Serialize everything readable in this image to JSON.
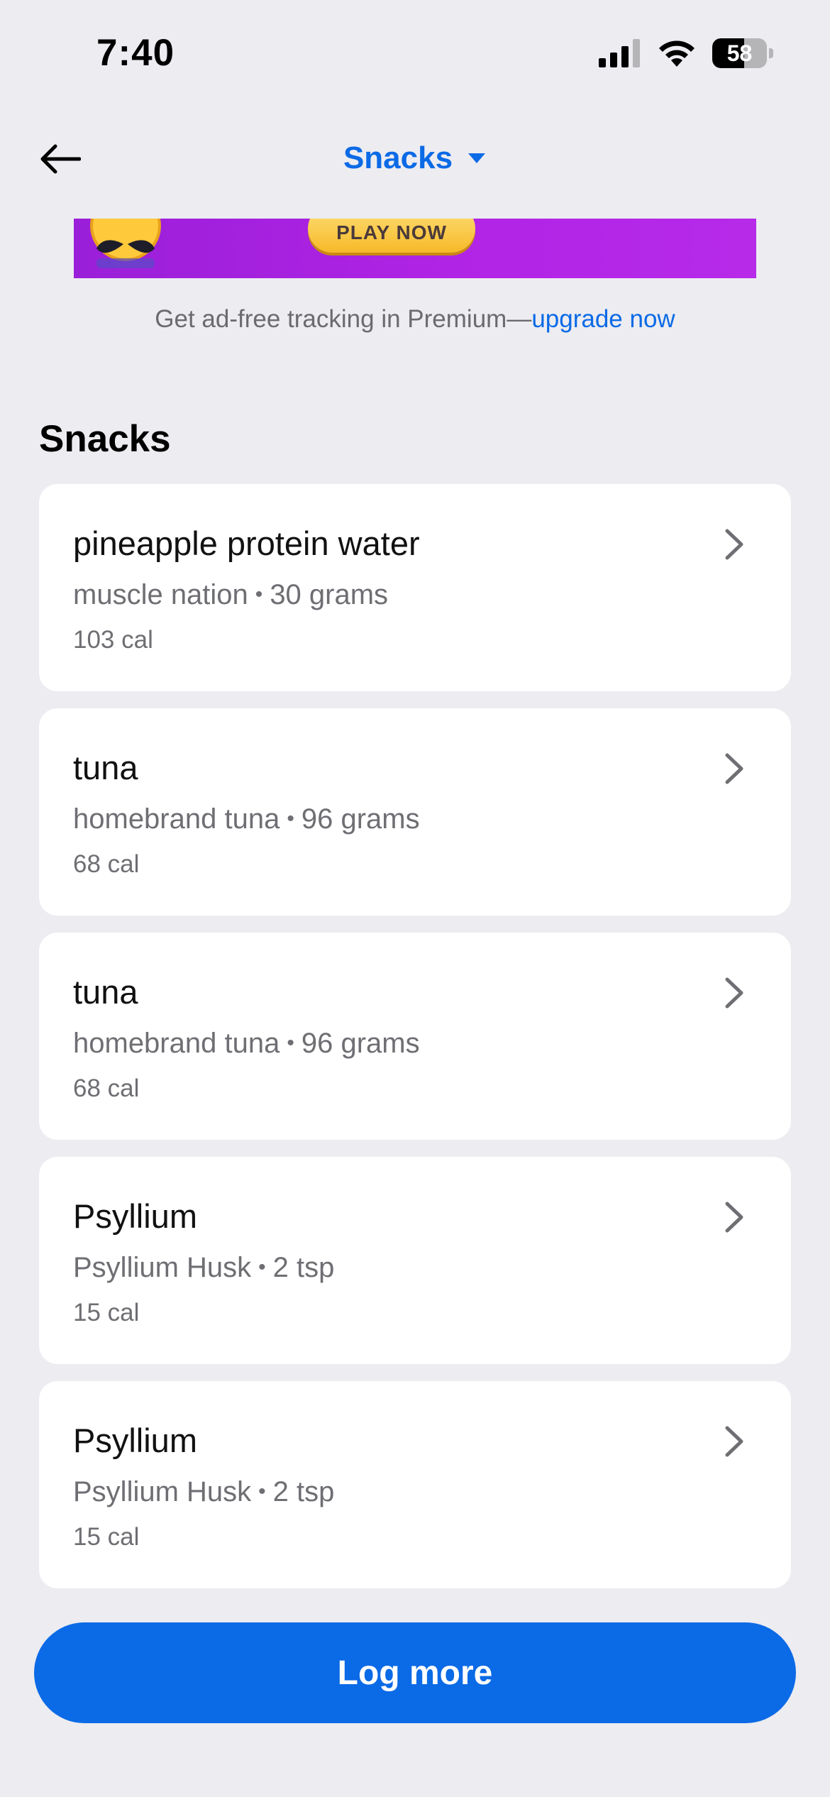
{
  "status_bar": {
    "time": "7:40",
    "battery": "58",
    "battery_level": 0.58,
    "icons": [
      "cellular-signal-icon",
      "wifi-icon",
      "battery-icon"
    ]
  },
  "header": {
    "title": "Snacks",
    "back_icon": "arrow-left-icon",
    "dropdown_icon": "caret-down-icon"
  },
  "ad": {
    "cta": "PLAY NOW"
  },
  "premium": {
    "text": "Get ad-free tracking in Premium—",
    "link": "upgrade now"
  },
  "section": {
    "title": "Snacks"
  },
  "foods": [
    {
      "name": "pineapple protein water",
      "brand": "muscle nation",
      "amount": "30 grams",
      "calories": "103 cal"
    },
    {
      "name": "tuna",
      "brand": "homebrand tuna",
      "amount": "96 grams",
      "calories": "68 cal"
    },
    {
      "name": "tuna",
      "brand": "homebrand tuna",
      "amount": "96 grams",
      "calories": "68 cal"
    },
    {
      "name": "Psyllium",
      "brand": "Psyllium Husk",
      "amount": "2 tsp",
      "calories": "15 cal"
    },
    {
      "name": "Psyllium",
      "brand": "Psyllium Husk",
      "amount": "2 tsp",
      "calories": "15 cal"
    }
  ],
  "separator": "•",
  "actions": {
    "log_more": "Log more"
  },
  "colors": {
    "accent": "#0B6AE6",
    "background": "#ECECF1",
    "card": "#FFFFFF",
    "secondary_text": "#6E6E73"
  }
}
